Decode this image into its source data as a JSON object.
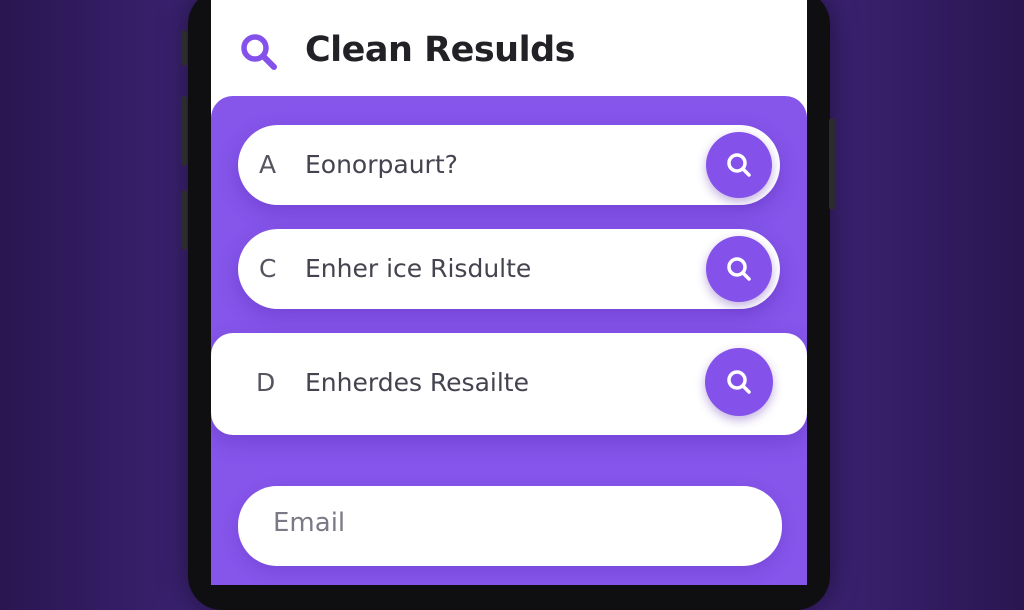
{
  "header": {
    "title": "Clean Resulds",
    "icon": "search-icon"
  },
  "results": [
    {
      "letter": "A",
      "text": "Eonorpaurt?",
      "action_icon": "search-icon"
    },
    {
      "letter": "C",
      "text": "Enher ice Risdulte",
      "action_icon": "search-icon"
    },
    {
      "letter": "D",
      "text": "Enherdes Resailte",
      "action_icon": "search-icon"
    }
  ],
  "email": {
    "placeholder": "Email"
  },
  "colors": {
    "accent": "#8655ea",
    "background": "#33205f",
    "title_text": "#222226"
  }
}
